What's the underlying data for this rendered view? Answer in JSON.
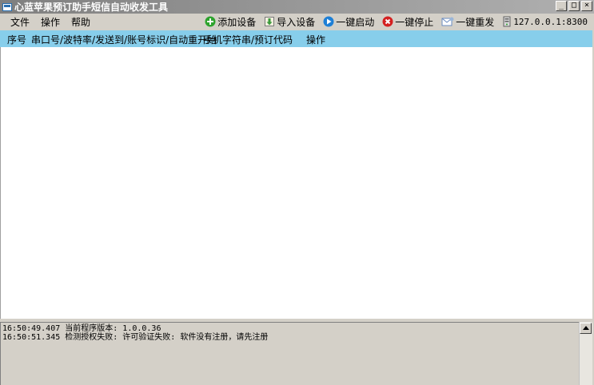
{
  "window": {
    "title": "心蓝苹果预订助手短信自动收发工具",
    "controls": {
      "minimize": "_",
      "maximize": "□",
      "close": "×"
    }
  },
  "menu": [
    {
      "label": "文件"
    },
    {
      "label": "操作"
    },
    {
      "label": "帮助"
    }
  ],
  "toolbar": {
    "add_device": {
      "label": "添加设备",
      "icon": "plus-circle-icon",
      "color": "#2ea32e"
    },
    "import_device": {
      "label": "导入设备",
      "icon": "import-icon",
      "color": "#3a9a3a"
    },
    "start_all": {
      "label": "一键启动",
      "icon": "play-circle-icon",
      "color": "#1e7fd6"
    },
    "stop_all": {
      "label": "一键停止",
      "icon": "stop-circle-icon",
      "color": "#d42020"
    },
    "resend_all": {
      "label": "一键重发",
      "icon": "envelope-icon",
      "color": "#6a8bbf"
    },
    "server": {
      "label": "127.0.0.1:8300",
      "icon": "server-icon"
    }
  },
  "table": {
    "header_color": "#87ceeb",
    "columns": [
      "序号",
      "串口号/波特率/发送到/账号标识/自动重开始",
      "手机字符串/预订代码",
      "操作"
    ],
    "rows": []
  },
  "log": {
    "lines": [
      "16:50:49.407 当前程序版本: 1.0.0.36",
      "16:50:51.345 检测授权失败: 许可验证失败:  软件没有注册，请先注册"
    ]
  }
}
